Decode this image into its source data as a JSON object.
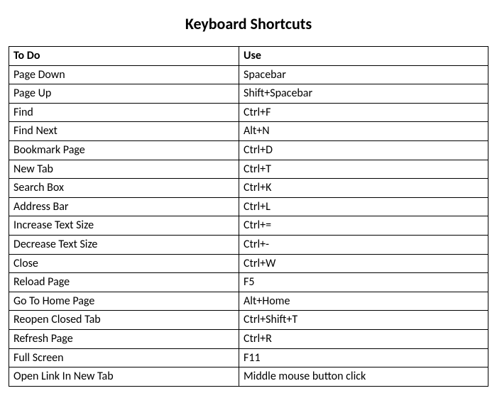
{
  "title": "Keyboard Shortcuts",
  "headers": {
    "action": "To Do",
    "key": "Use"
  },
  "rows": [
    {
      "action": "Page Down",
      "key": "Spacebar"
    },
    {
      "action": "Page Up",
      "key": "Shift+Spacebar"
    },
    {
      "action": "Find",
      "key": "Ctrl+F"
    },
    {
      "action": "Find Next",
      "key": "Alt+N"
    },
    {
      "action": "Bookmark Page",
      "key": "Ctrl+D"
    },
    {
      "action": "New Tab",
      "key": "Ctrl+T"
    },
    {
      "action": "Search Box",
      "key": "Ctrl+K"
    },
    {
      "action": "Address Bar",
      "key": "Ctrl+L"
    },
    {
      "action": "Increase Text Size",
      "key": "Ctrl+="
    },
    {
      "action": "Decrease Text Size",
      "key": "Ctrl+-"
    },
    {
      "action": "Close",
      "key": "Ctrl+W"
    },
    {
      "action": "Reload Page",
      "key": "F5"
    },
    {
      "action": "Go To Home Page",
      "key": "Alt+Home"
    },
    {
      "action": "Reopen Closed Tab",
      "key": "Ctrl+Shift+T"
    },
    {
      "action": "Refresh Page",
      "key": "Ctrl+R"
    },
    {
      "action": "Full Screen",
      "key": "F11"
    },
    {
      "action": "Open Link In New Tab",
      "key": "Middle mouse button click"
    }
  ]
}
